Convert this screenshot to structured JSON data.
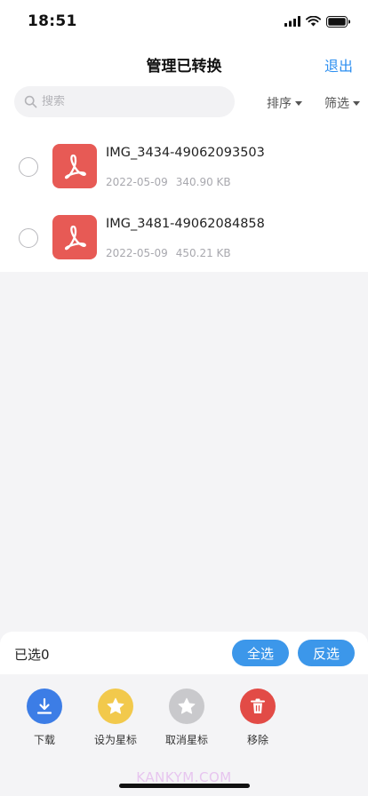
{
  "status_bar": {
    "time": "18:51"
  },
  "nav": {
    "title": "管理已转换",
    "exit_label": "退出"
  },
  "search": {
    "placeholder": "搜索",
    "value": ""
  },
  "toolbar": {
    "sort_label": "排序",
    "filter_label": "筛选"
  },
  "files": [
    {
      "name": "IMG_3434-49062093503",
      "date": "2022-05-09",
      "size": "340.90 KB",
      "selected": false
    },
    {
      "name": "IMG_3481-49062084858",
      "date": "2022-05-09",
      "size": "450.21 KB",
      "selected": false
    }
  ],
  "selection": {
    "count_label": "已选",
    "count": "0",
    "select_all_label": "全选",
    "invert_label": "反选"
  },
  "actions": [
    {
      "label": "下载",
      "icon": "download-icon",
      "color": "#3c7de6"
    },
    {
      "label": "设为星标",
      "icon": "star-icon",
      "color": "#f2c94c"
    },
    {
      "label": "取消星标",
      "icon": "star-outline-icon",
      "color": "#c9c9cc"
    },
    {
      "label": "移除",
      "icon": "trash-icon",
      "color": "#e24b46"
    }
  ],
  "watermark": "KANKYM.COM",
  "colors": {
    "accent": "#2d8ff0",
    "pill": "#3c97ea",
    "pdf": "#e75a55"
  }
}
